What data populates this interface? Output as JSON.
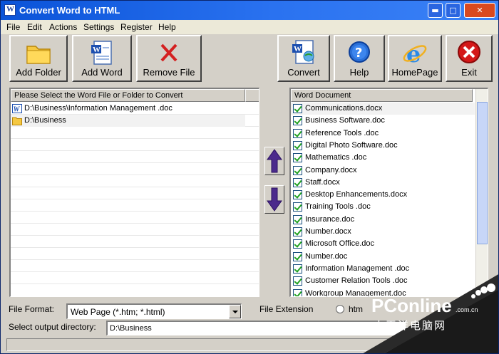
{
  "window": {
    "title": "Convert Word to HTML"
  },
  "titlebar_buttons": {
    "minimize": "▬",
    "maximize": "□",
    "close": "✕"
  },
  "menu": [
    "File",
    "Edit",
    "Actions",
    "Settings",
    "Register",
    "Help"
  ],
  "toolbar": {
    "add_folder": "Add Folder",
    "add_word": "Add Word",
    "remove_file": "Remove File",
    "convert": "Convert",
    "help": "Help",
    "homepage": "HomePage",
    "exit": "Exit"
  },
  "source_panel": {
    "header": "Please Select the Word File or Folder to Convert",
    "items": [
      {
        "type": "word-file",
        "path": "D:\\Business\\Information Management .doc"
      },
      {
        "type": "folder",
        "path": "D:\\Business"
      }
    ]
  },
  "documents_panel": {
    "header": "Word Document",
    "items": [
      {
        "name": "Communications.docx",
        "checked": true
      },
      {
        "name": "Business Software.doc",
        "checked": true
      },
      {
        "name": "Reference Tools .doc",
        "checked": true
      },
      {
        "name": "Digital Photo Software.doc",
        "checked": true
      },
      {
        "name": "Mathematics .doc",
        "checked": true
      },
      {
        "name": "Company.docx",
        "checked": true
      },
      {
        "name": "Staff.docx",
        "checked": true
      },
      {
        "name": "Desktop Enhancements.docx",
        "checked": true
      },
      {
        "name": "Training Tools .doc",
        "checked": true
      },
      {
        "name": "Insurance.doc",
        "checked": true
      },
      {
        "name": "Number.docx",
        "checked": true
      },
      {
        "name": "Microsoft Office.doc",
        "checked": true
      },
      {
        "name": "Number.doc",
        "checked": true
      },
      {
        "name": "Information Management .doc",
        "checked": true
      },
      {
        "name": "Customer Relation Tools .doc",
        "checked": true
      },
      {
        "name": "Workgroup Management.doc",
        "checked": true
      }
    ]
  },
  "options": {
    "file_format_label": "File Format:",
    "file_format_value": "Web Page (*.htm; *.html)",
    "file_extension_label": "File Extension",
    "extension_option": "htm",
    "output_dir_label": "Select  output directory:",
    "output_dir_value": "D:\\Business"
  },
  "watermark": {
    "brand": "PConline",
    "domain": ".com.cn",
    "tagline": "太平洋电脑网"
  },
  "colors": {
    "titlebar": "#0a53d8",
    "face": "#d4d0c8",
    "arrow": "#4b2a8c",
    "check": "#21a121"
  }
}
